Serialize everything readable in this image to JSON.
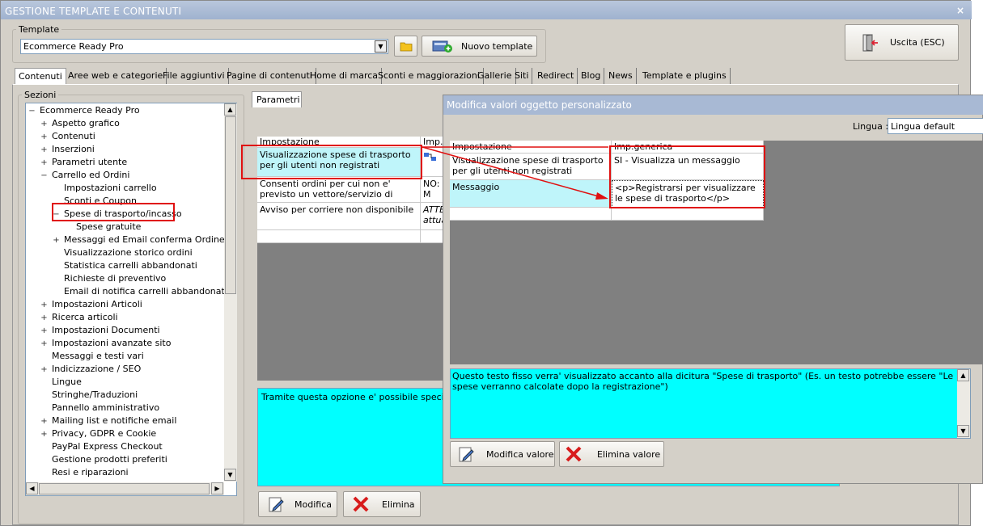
{
  "window": {
    "title": "GESTIONE TEMPLATE E CONTENUTI",
    "close_glyph": "×"
  },
  "template_group": {
    "legend": "Template",
    "selected": "Ecommerce Ready Pro",
    "folder_icon": "folder-icon",
    "new_button": "Nuovo template"
  },
  "exit_button": "Uscita (ESC)",
  "tabs": [
    "Contenuti",
    "Aree web e categorie",
    "File aggiuntivi",
    "Pagine di contenuti",
    "Home di marca",
    "Sconti e maggiorazioni",
    "Gallerie",
    "Siti",
    "Redirect",
    "Blog",
    "News",
    "Template e plugins"
  ],
  "sections": {
    "legend": "Sezioni",
    "tree": [
      {
        "label": "Ecommerce Ready Pro",
        "level": 0,
        "exp": "−"
      },
      {
        "label": "Aspetto grafico",
        "level": 1,
        "exp": "+"
      },
      {
        "label": "Contenuti",
        "level": 1,
        "exp": "+"
      },
      {
        "label": "Inserzioni",
        "level": 1,
        "exp": "+"
      },
      {
        "label": "Parametri utente",
        "level": 1,
        "exp": "+"
      },
      {
        "label": "Carrello ed Ordini",
        "level": 1,
        "exp": "−"
      },
      {
        "label": "Impostazioni carrello",
        "level": 2,
        "exp": ""
      },
      {
        "label": "Sconti e Coupon",
        "level": 2,
        "exp": ""
      },
      {
        "label": "Spese di trasporto/incasso",
        "level": 2,
        "exp": "−"
      },
      {
        "label": "Spese gratuite",
        "level": 3,
        "exp": ""
      },
      {
        "label": "Messaggi ed Email conferma Ordine",
        "level": 2,
        "exp": "+"
      },
      {
        "label": "Visualizzazione storico ordini",
        "level": 2,
        "exp": ""
      },
      {
        "label": "Statistica carrelli abbandonati",
        "level": 2,
        "exp": ""
      },
      {
        "label": "Richieste di preventivo",
        "level": 2,
        "exp": ""
      },
      {
        "label": "Email di notifica carrelli abbandonati",
        "level": 2,
        "exp": ""
      },
      {
        "label": "Impostazioni Articoli",
        "level": 1,
        "exp": "+"
      },
      {
        "label": "Ricerca articoli",
        "level": 1,
        "exp": "+"
      },
      {
        "label": "Impostazioni Documenti",
        "level": 1,
        "exp": "+"
      },
      {
        "label": "Impostazioni avanzate sito",
        "level": 1,
        "exp": "+"
      },
      {
        "label": "Messaggi e testi vari",
        "level": 1,
        "exp": ""
      },
      {
        "label": "Indicizzazione / SEO",
        "level": 1,
        "exp": "+"
      },
      {
        "label": "Lingue",
        "level": 1,
        "exp": ""
      },
      {
        "label": "Stringhe/Traduzioni",
        "level": 1,
        "exp": ""
      },
      {
        "label": "Pannello amministrativo",
        "level": 1,
        "exp": ""
      },
      {
        "label": "Mailing list e notifiche email",
        "level": 1,
        "exp": "+"
      },
      {
        "label": "Privacy, GDPR e Cookie",
        "level": 1,
        "exp": "+"
      },
      {
        "label": "PayPal Express Checkout",
        "level": 1,
        "exp": ""
      },
      {
        "label": "Gestione prodotti preferiti",
        "level": 1,
        "exp": ""
      },
      {
        "label": "Resi e riparazioni",
        "level": 1,
        "exp": ""
      }
    ]
  },
  "params": {
    "tab": "Parametri",
    "col_impostazione": "Impostazione",
    "col_imp": "Imp.g",
    "rows": [
      {
        "name": "Visualizzazione spese di trasporto per gli utenti non registrati",
        "value": ""
      },
      {
        "name": "Consenti ordini per cui non e' previsto un vettore/servizio di consegna",
        "value": "NO: M caso"
      },
      {
        "name": "Avviso per corriere non disponibile",
        "value": "ATTE attua"
      }
    ],
    "description": "Tramite questa opzione e' possibile specificare s registrato)",
    "modifica_button": "Modifica",
    "elimina_button": "Elimina"
  },
  "dialog": {
    "title": "Modifica valori oggetto personalizzato",
    "lingua_label": "Lingua :",
    "lingua_value": "Lingua default",
    "col_impostazione": "Impostazione",
    "col_generica": "Imp.generica",
    "rows": [
      {
        "name": "Visualizzazione spese di trasporto per gli utenti non registrati",
        "value": "SI - Visualizza un messaggio"
      },
      {
        "name": "Messaggio",
        "value": "<p>Registrarsi per visualizzare le spese di trasporto</p>"
      }
    ],
    "description": "Questo testo fisso verra' visualizzato accanto alla dicitura \"Spese di trasporto\" (Es. un  testo potrebbe essere \"Le spese verranno calcolate dopo la registrazione\")",
    "modifica_button": "Modifica valore",
    "elimina_button": "Elimina valore"
  },
  "colors": {
    "highlight_red": "#e01010",
    "cyan": "#00ffff",
    "light_cyan": "#bff5fa",
    "title_blue": "#a8b9d4"
  }
}
